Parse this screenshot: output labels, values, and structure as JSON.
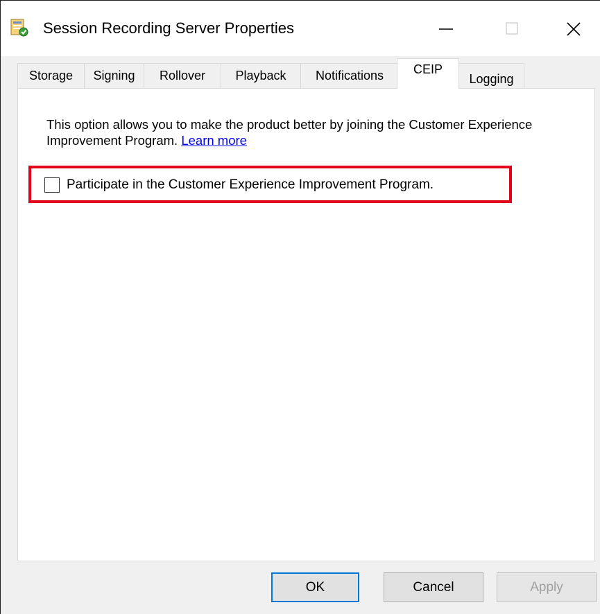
{
  "window": {
    "title": "Session Recording Server Properties"
  },
  "tabs": [
    {
      "label": "Storage"
    },
    {
      "label": "Signing"
    },
    {
      "label": "Rollover"
    },
    {
      "label": "Playback"
    },
    {
      "label": "Notifications"
    },
    {
      "label": "CEIP"
    },
    {
      "label": "Logging"
    }
  ],
  "active_tab": "CEIP",
  "ceip": {
    "description": "This option allows you to make the product better by joining the Customer Experience Improvement Program.",
    "learn_more": "Learn more",
    "checkbox_label": "Participate in the Customer Experience Improvement Program.",
    "checkbox_checked": false
  },
  "buttons": {
    "ok": "OK",
    "cancel": "Cancel",
    "apply": "Apply"
  },
  "colors": {
    "highlight_border": "#e3001b",
    "link": "#0000ee",
    "focus_border": "#0078d7"
  },
  "icons": {
    "app": "server-properties-icon",
    "minimize": "minimize-icon",
    "maximize": "maximize-icon",
    "close": "close-icon"
  }
}
